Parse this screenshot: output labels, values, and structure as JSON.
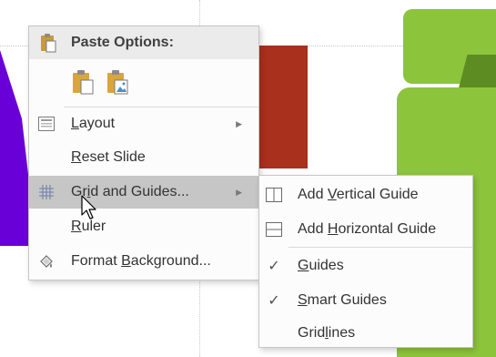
{
  "colors": {
    "purple_shape": "#6a00d8",
    "red_shape": "#a8301c",
    "green_shape": "#8cc43c",
    "menu_highlight": "#c6c6c6"
  },
  "main_menu": {
    "paste_options": {
      "label": "Paste Options:",
      "icon": "paste-icon",
      "buttons": [
        "paste-destination-theme-icon",
        "paste-as-picture-icon"
      ]
    },
    "items": [
      {
        "pre": "",
        "u": "L",
        "post": "ayout",
        "icon": "layout-icon",
        "has_submenu": true
      },
      {
        "pre": "",
        "u": "R",
        "post": "eset Slide",
        "icon": "",
        "has_submenu": false
      },
      {
        "pre": "Gr",
        "u": "i",
        "post": "d and Guides...",
        "icon": "grid-icon",
        "has_submenu": true,
        "highlighted": true
      },
      {
        "pre": "",
        "u": "R",
        "post": "uler",
        "icon": "",
        "has_submenu": false
      },
      {
        "pre": "Format ",
        "u": "B",
        "post": "ackground...",
        "icon": "format-background-icon",
        "has_submenu": false
      }
    ]
  },
  "sub_menu": {
    "items": [
      {
        "pre": "Add ",
        "u": "V",
        "post": "ertical Guide",
        "icon": "vertical-guide-icon",
        "checked": false
      },
      {
        "pre": "Add ",
        "u": "H",
        "post": "orizontal Guide",
        "icon": "horizontal-guide-icon",
        "checked": false
      },
      {
        "pre": "",
        "u": "G",
        "post": "uides",
        "icon": "",
        "checked": true
      },
      {
        "pre": "",
        "u": "S",
        "post": "mart Guides",
        "icon": "",
        "checked": true
      },
      {
        "pre": "Grid",
        "u": "l",
        "post": "ines",
        "icon": "",
        "checked": false
      }
    ],
    "check_glyph": "✓"
  }
}
